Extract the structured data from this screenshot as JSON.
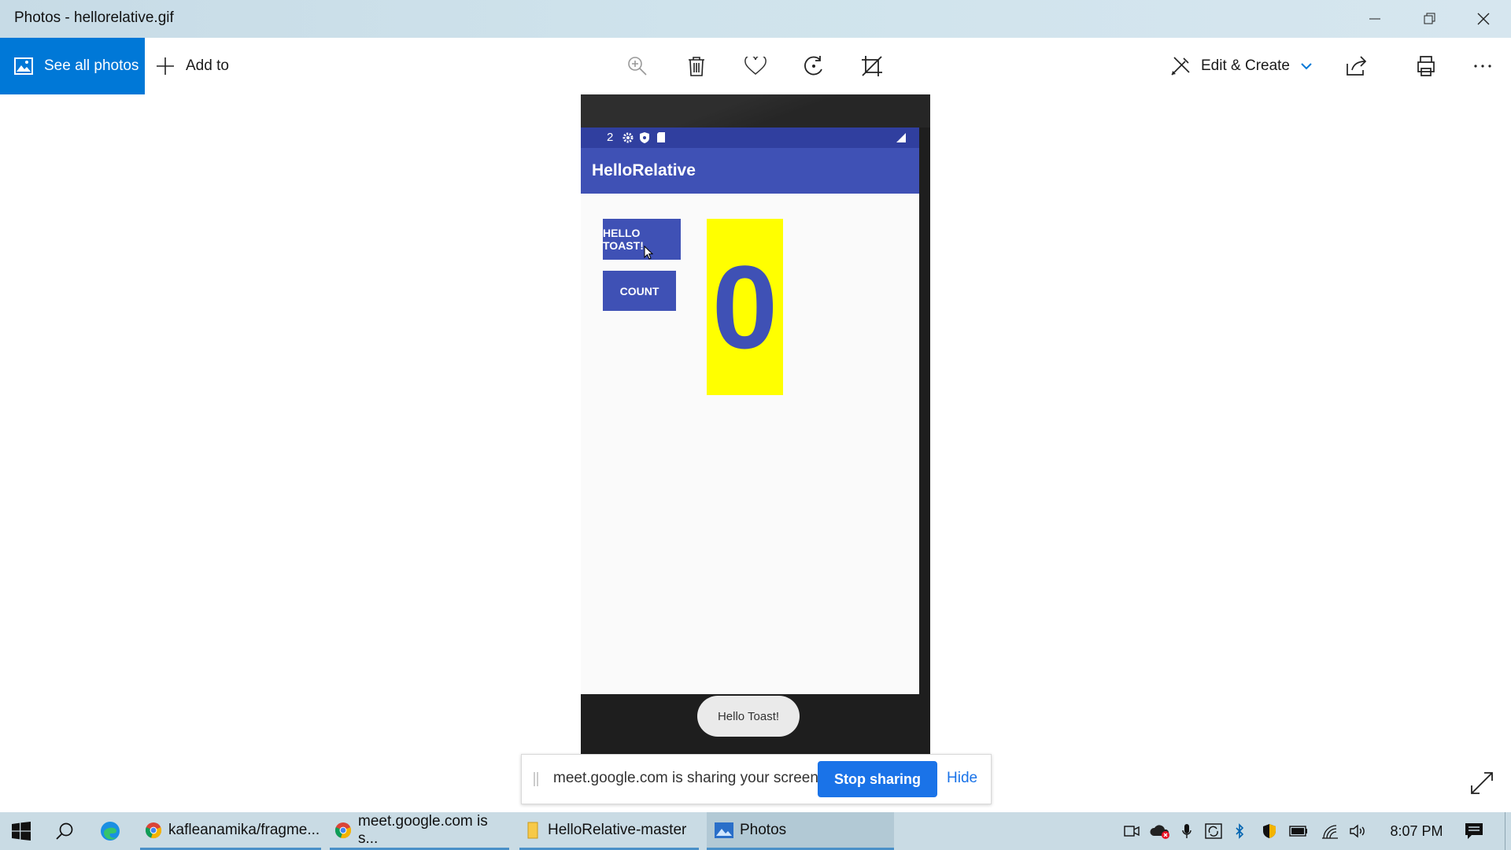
{
  "window": {
    "title": "Photos - hellorelative.gif"
  },
  "toolbar": {
    "see_all_label": "See all photos",
    "add_to_label": "Add to",
    "edit_create_label": "Edit & Create"
  },
  "device": {
    "status_notification_count": "2",
    "app_title": "HelloRelative",
    "hello_button_label": "HELLO TOAST!",
    "count_button_label": "COUNT",
    "count_value": "0",
    "toast_text": "Hello Toast!",
    "colors": {
      "primary": "#3f51b5",
      "primary_dark": "#303f9f",
      "count_bg": "#ffff00"
    }
  },
  "sharing": {
    "message": "meet.google.com is sharing your screen.",
    "stop_label": "Stop sharing",
    "hide_label": "Hide"
  },
  "taskbar": {
    "items": [
      {
        "label": "kafleanamika/fragme...",
        "icon": "chrome-icon"
      },
      {
        "label": "meet.google.com is s...",
        "icon": "chrome-icon"
      },
      {
        "label": "HelloRelative-master",
        "icon": "folder-icon"
      },
      {
        "label": "Photos",
        "icon": "photos-icon"
      }
    ],
    "clock": "8:07 PM"
  },
  "colors": {
    "accent": "#0078d7",
    "meet_blue": "#1a73e8"
  }
}
